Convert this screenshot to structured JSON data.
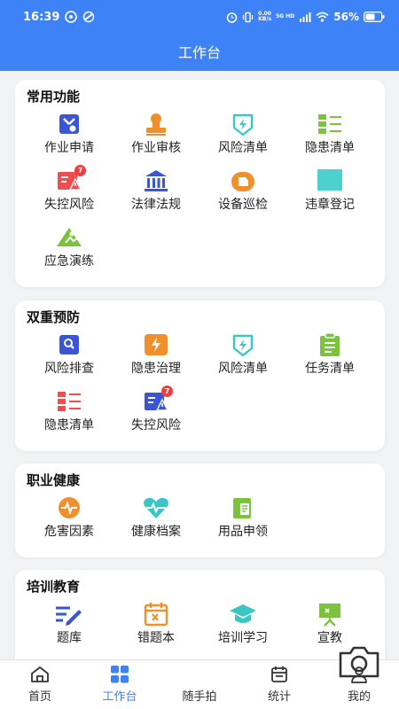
{
  "status_bar": {
    "time": "16:39",
    "net_speed_top": "0.00",
    "net_speed_bottom": "KB/s",
    "net_type": "5G HD",
    "battery": "56%"
  },
  "header": {
    "title": "工作台"
  },
  "sections": [
    {
      "title": "常用功能",
      "items": [
        {
          "label": "作业申请",
          "icon": "tools-heart-icon",
          "color": "#3a56d4"
        },
        {
          "label": "作业审核",
          "icon": "stamp-icon",
          "color": "#f0902c"
        },
        {
          "label": "风险清单",
          "icon": "lightning-shield-icon",
          "color": "#3ac6c4"
        },
        {
          "label": "隐患清单",
          "icon": "list-icon",
          "color": "#7cc33d"
        },
        {
          "label": "失控风险",
          "icon": "warning-list-icon",
          "color": "#f04e4e",
          "badge": "7"
        },
        {
          "label": "法律法规",
          "icon": "courthouse-icon",
          "color": "#3a56d4"
        },
        {
          "label": "设备巡检",
          "icon": "inspection-icon",
          "color": "#f0902c"
        },
        {
          "label": "违章登记",
          "icon": "square-icon",
          "color": "#4fd0d0"
        },
        {
          "label": "应急演练",
          "icon": "emergency-drill-icon",
          "color": "#7cc33d"
        }
      ]
    },
    {
      "title": "双重预防",
      "items": [
        {
          "label": "风险排查",
          "icon": "search-doc-icon",
          "color": "#3a56d4"
        },
        {
          "label": "隐患治理",
          "icon": "lightning-icon",
          "color": "#f0902c"
        },
        {
          "label": "风险清单",
          "icon": "lightning-shield-icon",
          "color": "#3ac6c4"
        },
        {
          "label": "任务清单",
          "icon": "clipboard-icon",
          "color": "#7cc33d"
        },
        {
          "label": "隐患清单",
          "icon": "list-icon",
          "color": "#f04e4e"
        },
        {
          "label": "失控风险",
          "icon": "warning-list-icon",
          "color": "#3a56d4",
          "badge": "7"
        }
      ]
    },
    {
      "title": "职业健康",
      "items": [
        {
          "label": "危害因素",
          "icon": "pulse-icon",
          "color": "#f0902c"
        },
        {
          "label": "健康档案",
          "icon": "heart-pulse-icon",
          "color": "#3ac6c4"
        },
        {
          "label": "用品申领",
          "icon": "documents-icon",
          "color": "#7cc33d"
        }
      ]
    },
    {
      "title": "培训教育",
      "items": [
        {
          "label": "题库",
          "icon": "pencil-lines-icon",
          "color": "#3a56d4"
        },
        {
          "label": "错题本",
          "icon": "calendar-x-icon",
          "color": "#f0902c"
        },
        {
          "label": "培训学习",
          "icon": "graduation-cap-icon",
          "color": "#3ac6c4"
        },
        {
          "label": "宣教",
          "icon": "presentation-board-icon",
          "color": "#7cc33d"
        }
      ]
    }
  ],
  "tabbar": {
    "items": [
      {
        "label": "首页",
        "icon": "home-icon"
      },
      {
        "label": "工作台",
        "icon": "grid-icon",
        "active": true
      },
      {
        "label": "随手拍",
        "icon": "camera-icon"
      },
      {
        "label": "统计",
        "icon": "calendar-icon"
      },
      {
        "label": "我的",
        "icon": "user-icon"
      }
    ],
    "active_color": "#3e82f7"
  }
}
